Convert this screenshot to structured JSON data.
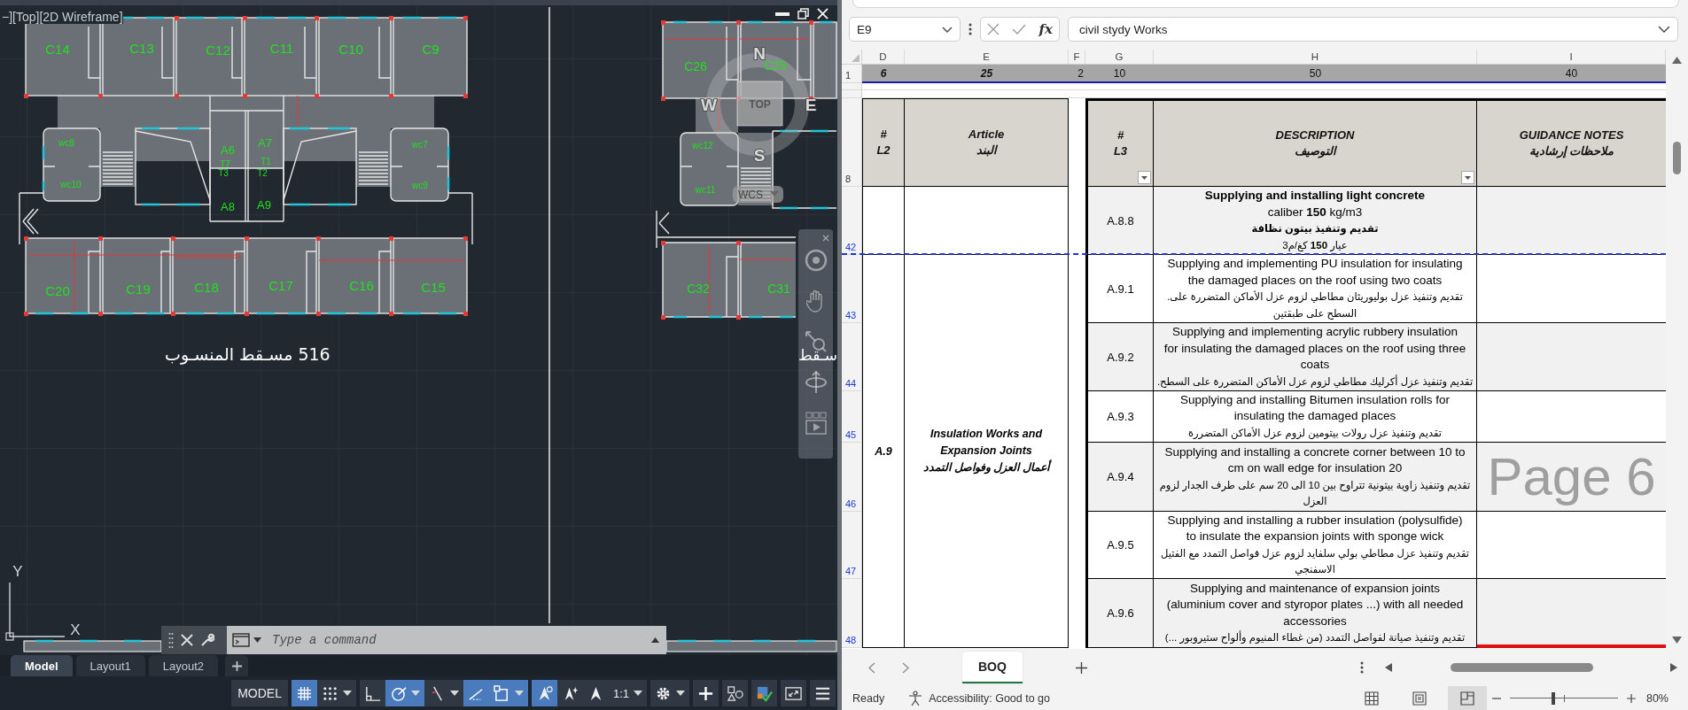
{
  "cad": {
    "viewport_label": "−][Top][2D Wireframe]",
    "plans": [
      {
        "labels": [
          "C14",
          "C13",
          "C12",
          "C11",
          "C10",
          "C9",
          "wc8",
          "A6",
          "A7",
          "wc7",
          "T7",
          "T1",
          "T3",
          "T2",
          "wc10",
          "wc9",
          "A8",
          "A9",
          "C20",
          "C19",
          "C18",
          "C17",
          "C16",
          "C15"
        ]
      },
      {
        "labels": [
          "C26",
          "C25",
          "wc12",
          "wc11",
          "C32",
          "C31"
        ]
      }
    ],
    "plan_titles": [
      "سـقط",
      "516 مسـقط المنسـوب"
    ],
    "viewcube": {
      "compass": [
        "N",
        "W",
        "E",
        "S"
      ],
      "face": "TOP",
      "ucs_menu": "WCS"
    },
    "ucs": {
      "y": "Y",
      "x": "X"
    },
    "command_line": {
      "placeholder": "Type a command"
    },
    "layout_tabs": [
      {
        "label": "Model",
        "selected": true
      },
      {
        "label": "Layout1",
        "selected": false
      },
      {
        "label": "Layout2",
        "selected": false
      }
    ],
    "status_groups": [
      [
        {
          "kind": "model",
          "label": "MODEL",
          "on": false,
          "caret": false
        }
      ],
      [
        {
          "kind": "grid",
          "on": true,
          "caret": false
        },
        {
          "kind": "snap",
          "on": false,
          "caret": true
        }
      ],
      [
        {
          "kind": "ortho",
          "on": false,
          "caret": false
        },
        {
          "kind": "polar",
          "on": true,
          "caret": true
        },
        {
          "kind": "isodraft",
          "on": false,
          "caret": true
        },
        {
          "kind": "track",
          "on": true,
          "caret": false
        },
        {
          "kind": "osnap",
          "on": true,
          "caret": true
        }
      ],
      [
        {
          "kind": "annovisibility",
          "on": true,
          "caret": false
        },
        {
          "kind": "autoscale",
          "on": false,
          "caret": false
        },
        {
          "kind": "annoscale",
          "on": false,
          "caret": false
        },
        {
          "kind": "scale",
          "label": "1:1",
          "on": false,
          "caret": true
        }
      ],
      [
        {
          "kind": "customize",
          "on": false,
          "caret": true
        }
      ],
      [
        {
          "kind": "plus",
          "on": false,
          "caret": false
        }
      ],
      [
        {
          "kind": "isolate",
          "on": false,
          "caret": false
        }
      ],
      [
        {
          "kind": "hardware",
          "on": false,
          "caret": false
        }
      ],
      [
        {
          "kind": "fullscreen",
          "on": false,
          "caret": false
        }
      ],
      [
        {
          "kind": "menu",
          "on": false,
          "caret": false
        }
      ]
    ]
  },
  "excel": {
    "name_box": "E9",
    "fx": "fx",
    "formula": "civil stydy Works",
    "columns": [
      "D",
      "E",
      "F",
      "G",
      "H",
      "I"
    ],
    "row1": {
      "number": "1",
      "cells": [
        {
          "text": "6",
          "bold": true
        },
        {
          "text": "25",
          "bold": true
        },
        {
          "text": "2",
          "bold": false
        },
        {
          "text": "10",
          "bold": false
        },
        {
          "text": "50",
          "bold": false
        },
        {
          "text": "40",
          "bold": false
        }
      ]
    },
    "header_row": {
      "number": "8",
      "cells": [
        {
          "lines": [
            "#",
            "L2"
          ],
          "filter": false
        },
        {
          "lines": [
            "Article",
            "البند"
          ],
          "filter": false
        },
        {
          "lines": [
            "#",
            "L3"
          ],
          "filter": true
        },
        {
          "lines": [
            "DESCRIPTION",
            "التوصيف"
          ],
          "filter": true
        },
        {
          "lines": [
            "GUIDANCE NOTES",
            "ملاحظات إرشادية"
          ],
          "filter": false
        }
      ]
    },
    "sections": [
      {
        "rows": [
          {
            "number": "42",
            "shaded": true,
            "page_break": true,
            "code": "A.8.8",
            "lines": [
              "**Supplying and installing light concrete**",
              "caliber **150** kg/m3",
              "**تقديم وتنفيذ بيتون نظافة**",
              "عيار **150** كغ/م3"
            ]
          }
        ]
      },
      {
        "code": "A.9",
        "article": [
          "Insulation Works and",
          "Expansion Joints",
          "أعمال العزل وفواصل التمدد"
        ],
        "rows": [
          {
            "number": "43",
            "shaded": false,
            "page_break": false,
            "code": "A.9.1",
            "lines": [
              "Supplying and implementing PU insulation for insulating",
              "the damaged places on the roof using two coats",
              ".تقديم وتنفيذ عزل بوليوريثان مطاطي لزوم عزل الأماكن المتضررة على",
              "السطح على طبقتين"
            ]
          },
          {
            "number": "44",
            "shaded": true,
            "page_break": false,
            "code": "A.9.2",
            "lines": [
              "Supplying and implementing acrylic rubbery insulation",
              "for insulating the damaged places on the roof using three",
              "coats",
              ".تقديم وتنفيذ عزل أكرليك مطاطي لزوم عزل الأماكن المتضررة على السطح"
            ]
          },
          {
            "number": "45",
            "shaded": false,
            "page_break": false,
            "code": "A.9.3",
            "lines": [
              "Supplying and installing Bitumen insulation rolls for",
              "insulating the damaged places",
              "تقديم وتنفيذ عزل رولات بيتومين لزوم عزل الأماكن المتضررة"
            ]
          },
          {
            "number": "46",
            "shaded": true,
            "page_break": false,
            "code": "A.9.4",
            "lines": [
              "Supplying and installing a concrete corner between 10 to",
              "cm on wall edge for insulation 20",
              "تقديم وتنفيذ زاوية بيتونية تتراوح بين 10 الى 20 سم على طرف الجدار لزوم",
              "العزل"
            ]
          },
          {
            "number": "47",
            "shaded": false,
            "page_break": false,
            "code": "A.9.5",
            "lines": [
              "Supplying and installing a rubber insulation (polysulfide)",
              "to insulate the expansion joints with sponge wick",
              "تقديم وتنفيذ عزل مطاطي بولي سلفايد لزوم عزل فواصل التمدد مع الفتيل",
              "الاسفنجي"
            ]
          },
          {
            "number": "48",
            "shaded": true,
            "page_break": false,
            "code": "A.9.6",
            "lines": [
              "Supplying and maintenance of expansion joints",
              "(aluminium cover and styropor plates ...) with all needed",
              "accessories",
              "تقديم وتنفيذ صيانة لفواصل التمدد (من غطاء المنيوم وألواح ستيروبور ...)"
            ]
          }
        ]
      }
    ],
    "page_label": "Page 6",
    "sheet_tabs": [
      {
        "label": "BOQ",
        "selected": true
      }
    ],
    "status": {
      "ready": "Ready",
      "accessibility": "Accessibility: Good to go",
      "views": [
        {
          "kind": "normal",
          "selected": false
        },
        {
          "kind": "page_layout",
          "selected": false
        },
        {
          "kind": "page_break",
          "selected": true
        }
      ],
      "zoom": {
        "level": 0.4
      },
      "zoom_text": "80%"
    }
  }
}
